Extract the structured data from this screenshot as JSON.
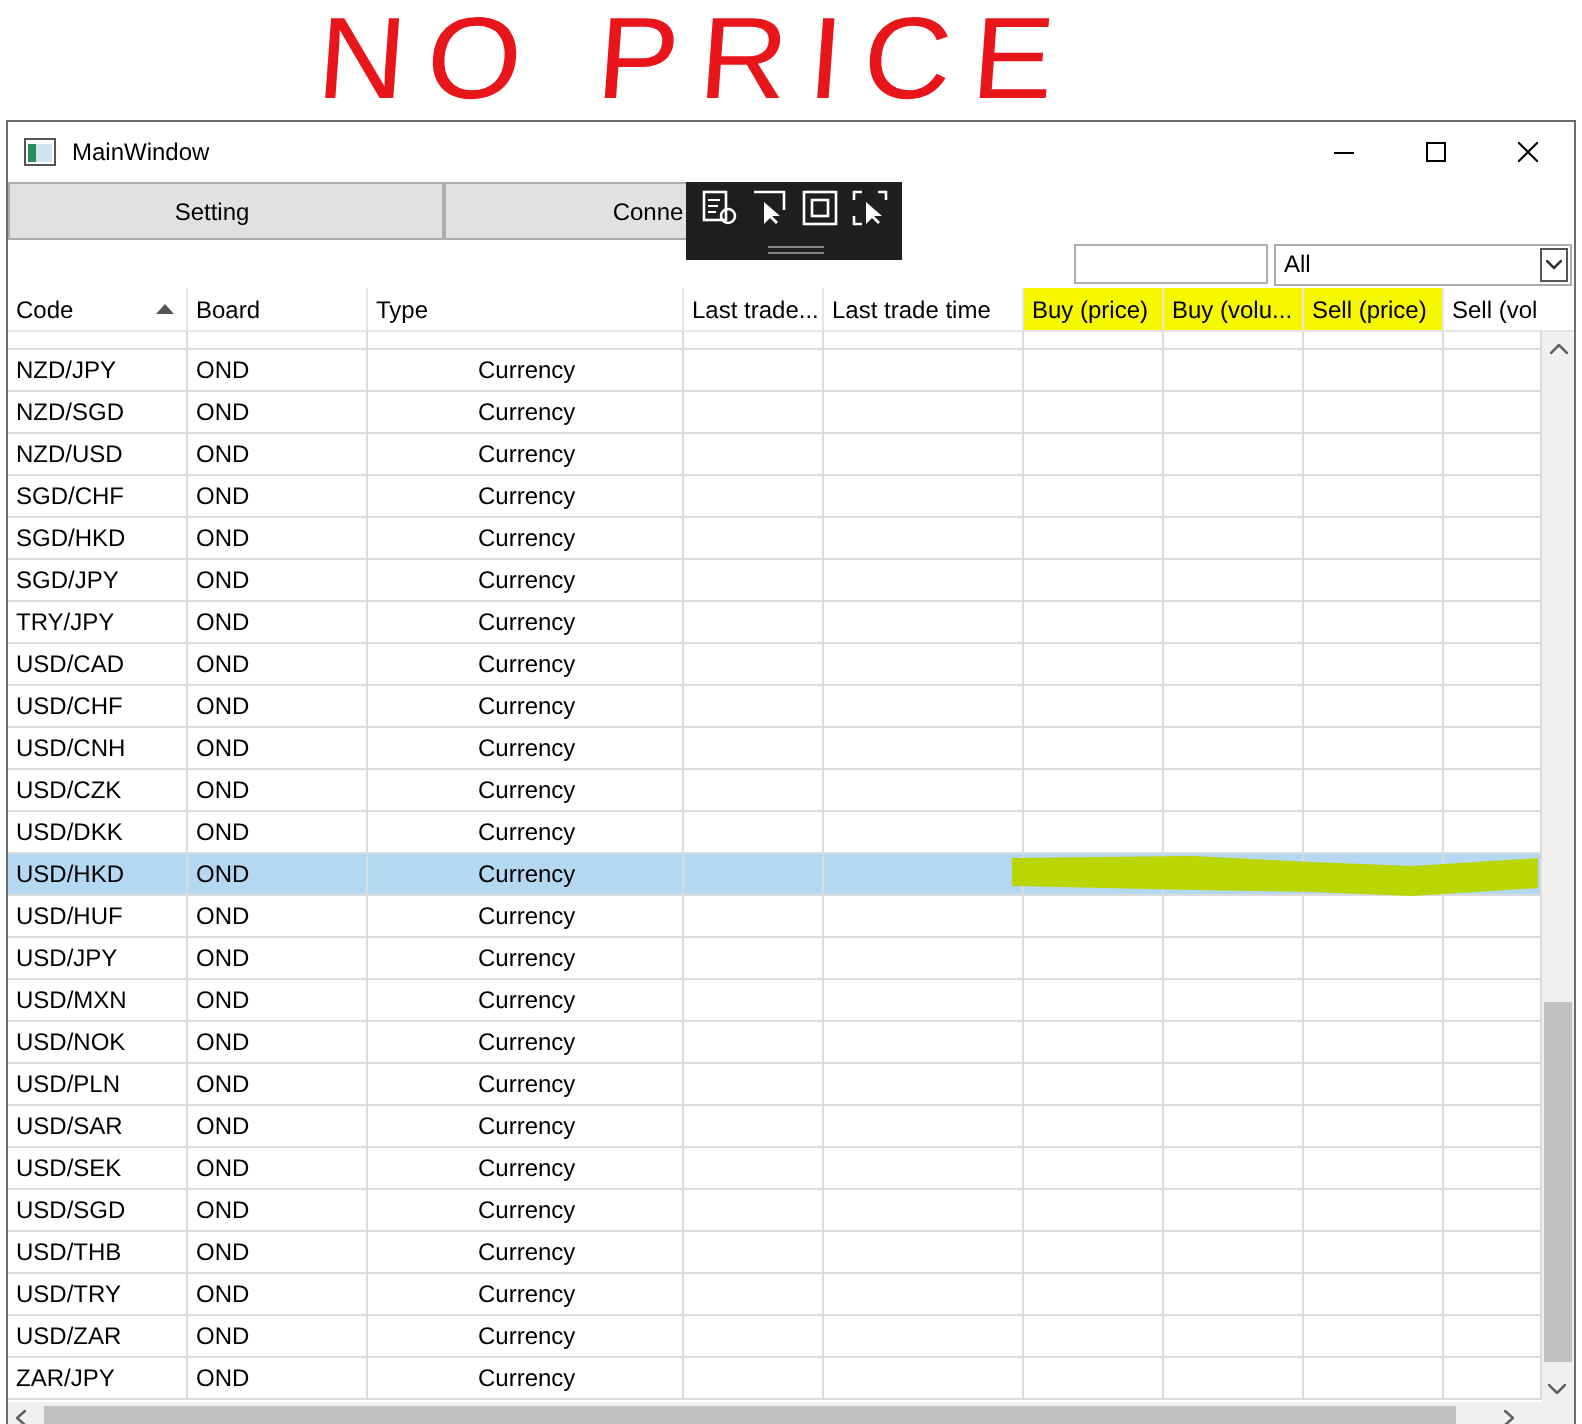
{
  "annotation": {
    "text": "NO PRICE"
  },
  "window": {
    "title": "MainWindow"
  },
  "buttons": [
    {
      "label": "Setting"
    },
    {
      "label": "Conne"
    }
  ],
  "filter": {
    "combo_value": "All"
  },
  "table": {
    "columns": [
      {
        "label": "Code",
        "sorted": true,
        "highlighted": false
      },
      {
        "label": "Board",
        "sorted": false,
        "highlighted": false
      },
      {
        "label": "Type",
        "sorted": false,
        "highlighted": false
      },
      {
        "label": "Last trade...",
        "sorted": false,
        "highlighted": false
      },
      {
        "label": "Last trade time",
        "sorted": false,
        "highlighted": false
      },
      {
        "label": "Buy (price)",
        "sorted": false,
        "highlighted": true
      },
      {
        "label": "Buy (volu...",
        "sorted": false,
        "highlighted": true
      },
      {
        "label": "Sell (price)",
        "sorted": false,
        "highlighted": true
      },
      {
        "label": "Sell (vol",
        "sorted": false,
        "highlighted": false
      }
    ],
    "rows": [
      {
        "code": "NZD/JPY",
        "board": "OND",
        "type": "Currency",
        "selected": false,
        "marked": false
      },
      {
        "code": "NZD/SGD",
        "board": "OND",
        "type": "Currency",
        "selected": false,
        "marked": false
      },
      {
        "code": "NZD/USD",
        "board": "OND",
        "type": "Currency",
        "selected": false,
        "marked": false
      },
      {
        "code": "SGD/CHF",
        "board": "OND",
        "type": "Currency",
        "selected": false,
        "marked": false
      },
      {
        "code": "SGD/HKD",
        "board": "OND",
        "type": "Currency",
        "selected": false,
        "marked": false
      },
      {
        "code": "SGD/JPY",
        "board": "OND",
        "type": "Currency",
        "selected": false,
        "marked": false
      },
      {
        "code": "TRY/JPY",
        "board": "OND",
        "type": "Currency",
        "selected": false,
        "marked": false
      },
      {
        "code": "USD/CAD",
        "board": "OND",
        "type": "Currency",
        "selected": false,
        "marked": false
      },
      {
        "code": "USD/CHF",
        "board": "OND",
        "type": "Currency",
        "selected": false,
        "marked": false
      },
      {
        "code": "USD/CNH",
        "board": "OND",
        "type": "Currency",
        "selected": false,
        "marked": false
      },
      {
        "code": "USD/CZK",
        "board": "OND",
        "type": "Currency",
        "selected": false,
        "marked": false
      },
      {
        "code": "USD/DKK",
        "board": "OND",
        "type": "Currency",
        "selected": false,
        "marked": false
      },
      {
        "code": "USD/HKD",
        "board": "OND",
        "type": "Currency",
        "selected": true,
        "marked": true
      },
      {
        "code": "USD/HUF",
        "board": "OND",
        "type": "Currency",
        "selected": false,
        "marked": false
      },
      {
        "code": "USD/JPY",
        "board": "OND",
        "type": "Currency",
        "selected": false,
        "marked": false
      },
      {
        "code": "USD/MXN",
        "board": "OND",
        "type": "Currency",
        "selected": false,
        "marked": false
      },
      {
        "code": "USD/NOK",
        "board": "OND",
        "type": "Currency",
        "selected": false,
        "marked": false
      },
      {
        "code": "USD/PLN",
        "board": "OND",
        "type": "Currency",
        "selected": false,
        "marked": false
      },
      {
        "code": "USD/SAR",
        "board": "OND",
        "type": "Currency",
        "selected": false,
        "marked": false
      },
      {
        "code": "USD/SEK",
        "board": "OND",
        "type": "Currency",
        "selected": false,
        "marked": false
      },
      {
        "code": "USD/SGD",
        "board": "OND",
        "type": "Currency",
        "selected": false,
        "marked": false
      },
      {
        "code": "USD/THB",
        "board": "OND",
        "type": "Currency",
        "selected": false,
        "marked": false
      },
      {
        "code": "USD/TRY",
        "board": "OND",
        "type": "Currency",
        "selected": false,
        "marked": false
      },
      {
        "code": "USD/ZAR",
        "board": "OND",
        "type": "Currency",
        "selected": false,
        "marked": false
      },
      {
        "code": "ZAR/JPY",
        "board": "OND",
        "type": "Currency",
        "selected": false,
        "marked": false
      }
    ]
  }
}
